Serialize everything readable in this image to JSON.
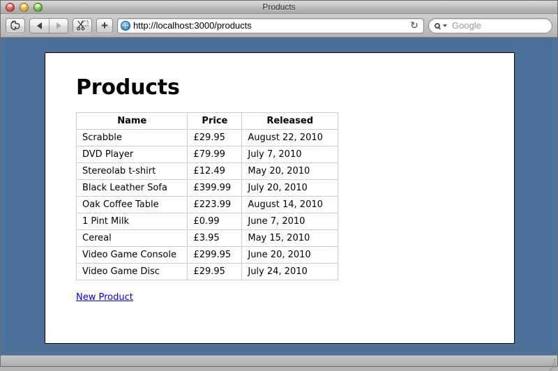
{
  "window": {
    "title": "Products",
    "traffic_lights": [
      {
        "name": "close",
        "color": "#e23d32"
      },
      {
        "name": "minimize",
        "color": "#e7a21c"
      },
      {
        "name": "maximize",
        "color": "#55b228"
      }
    ]
  },
  "toolbar": {
    "clipper_icon": "elephant-icon",
    "back_icon": "back-arrow-icon",
    "forward_icon": "forward-arrow-icon",
    "clip_icon": "scissors-icon",
    "add_tab_label": "+",
    "address": {
      "site_icon": "globe-icon",
      "url": "http://localhost:3000/products",
      "reload_glyph": "↻"
    },
    "search": {
      "icon": "magnifier-icon",
      "placeholder": "Google",
      "value": ""
    }
  },
  "page": {
    "heading": "Products",
    "background_color": "#4c729b",
    "link_color": "#0000ee",
    "table": {
      "headers": [
        "Name",
        "Price",
        "Released"
      ],
      "rows": [
        {
          "name": "Scrabble",
          "price": "£29.95",
          "released": "August 22, 2010"
        },
        {
          "name": "DVD Player",
          "price": "£79.99",
          "released": "July 7, 2010"
        },
        {
          "name": "Stereolab t-shirt",
          "price": "£12.49",
          "released": "May 20, 2010"
        },
        {
          "name": "Black Leather Sofa",
          "price": "£399.99",
          "released": "July 20, 2010"
        },
        {
          "name": "Oak Coffee Table",
          "price": "£223.99",
          "released": "August 14, 2010"
        },
        {
          "name": "1 Pint Milk",
          "price": "£0.99",
          "released": "June 7, 2010"
        },
        {
          "name": "Cereal",
          "price": "£3.95",
          "released": "May 15, 2010"
        },
        {
          "name": "Video Game Console",
          "price": "£299.95",
          "released": "June 20, 2010"
        },
        {
          "name": "Video Game Disc",
          "price": "£29.95",
          "released": "July 24, 2010"
        }
      ]
    },
    "new_product_link": "New Product"
  }
}
